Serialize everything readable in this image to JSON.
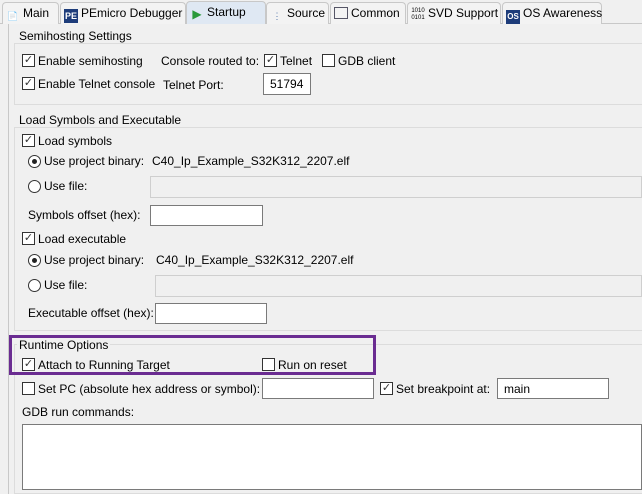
{
  "tabs": [
    {
      "label": "Main",
      "icon": "document-icon"
    },
    {
      "label": "PEmicro Debugger",
      "icon": "pemicro-icon"
    },
    {
      "label": "Startup",
      "icon": "play-icon",
      "selected": true
    },
    {
      "label": "Source",
      "icon": "source-icon"
    },
    {
      "label": "Common",
      "icon": "table-icon"
    },
    {
      "label": "SVD Support",
      "icon": "binary-icon"
    },
    {
      "label": "OS Awareness",
      "icon": "os-icon"
    }
  ],
  "semihosting": {
    "title": "Semihosting Settings",
    "enable_semihosting": {
      "label": "Enable semihosting",
      "checked": true
    },
    "enable_telnet": {
      "label": "Enable Telnet console",
      "checked": true
    },
    "console_routed_label": "Console routed to:",
    "telnet": {
      "label": "Telnet",
      "checked": true
    },
    "gdb_client": {
      "label": "GDB client",
      "checked": false
    },
    "telnet_port_label": "Telnet Port:",
    "telnet_port": "51794"
  },
  "load": {
    "title": "Load Symbols and Executable",
    "load_symbols": {
      "label": "Load symbols",
      "checked": true
    },
    "sym_use_project": "Use project binary:",
    "sym_project_value": "C40_Ip_Example_S32K312_2207.elf",
    "sym_use_file": "Use file:",
    "sym_offset_label": "Symbols offset (hex):",
    "sym_offset": "",
    "load_executable": {
      "label": "Load executable",
      "checked": true
    },
    "exe_use_project": "Use project binary:",
    "exe_project_value": "C40_Ip_Example_S32K312_2207.elf",
    "exe_use_file": "Use file:",
    "exe_offset_label": "Executable offset (hex):",
    "exe_offset": ""
  },
  "runtime": {
    "title": "Runtime Options",
    "attach": {
      "label": "Attach to Running Target",
      "checked": true
    },
    "run_on_reset": {
      "label": "Run on reset",
      "checked": false
    },
    "set_pc": {
      "label": "Set PC (absolute hex address or symbol):",
      "checked": false
    },
    "set_pc_value": "",
    "set_breakpoint": {
      "label": "Set breakpoint at:",
      "checked": true
    },
    "breakpoint_value": "main",
    "gdb_cmds_label": "GDB run commands:",
    "gdb_cmds": ""
  },
  "highlight_color": "#6a2c91"
}
